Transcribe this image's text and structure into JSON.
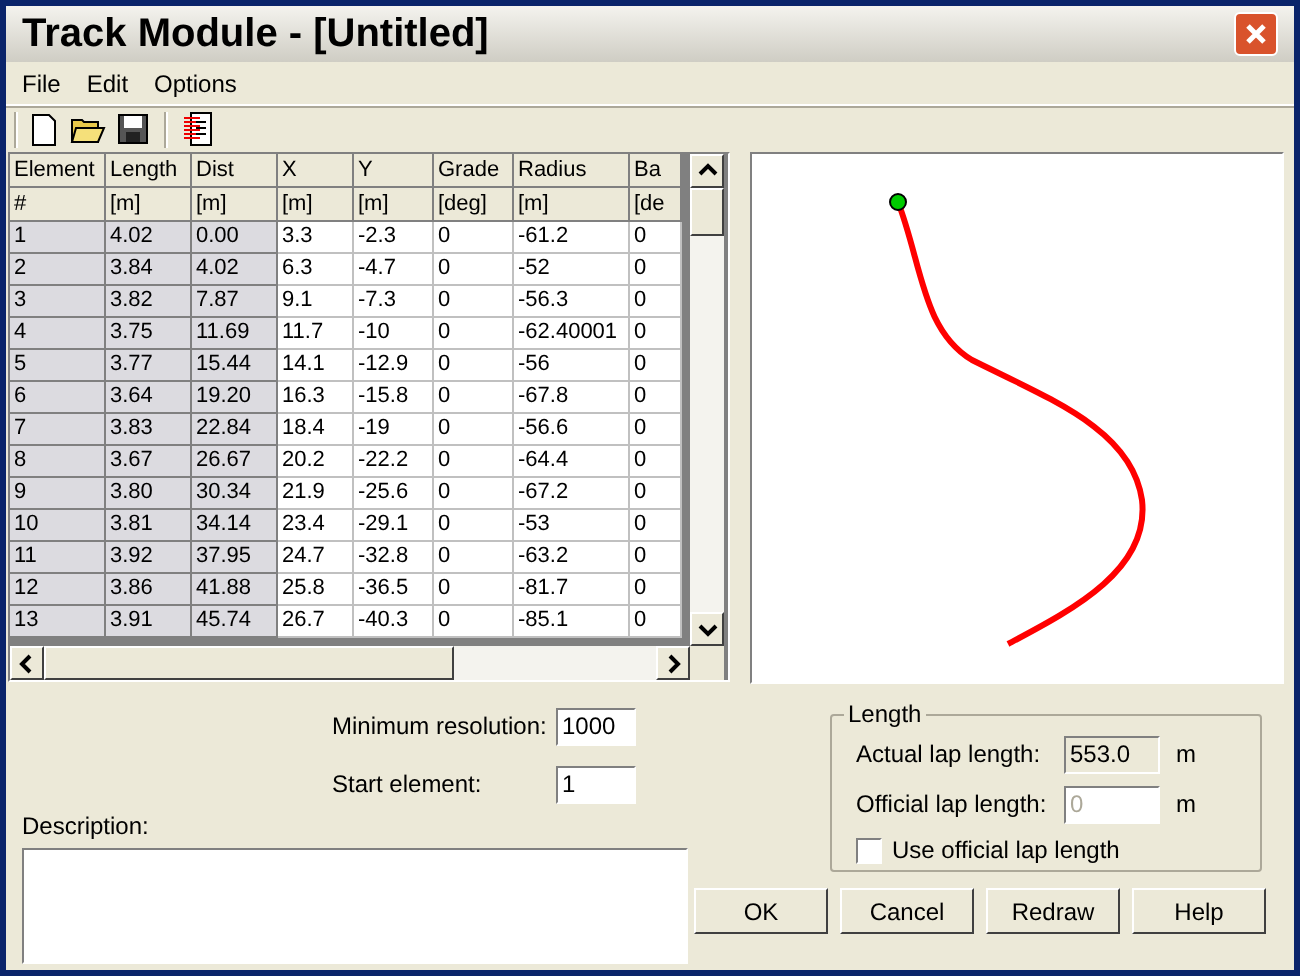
{
  "window": {
    "title": "Track Module - [Untitled]"
  },
  "menu": [
    "File",
    "Edit",
    "Options"
  ],
  "table": {
    "columns": [
      {
        "label": "Element",
        "unit": "#",
        "fixed": true
      },
      {
        "label": "Length",
        "unit": "[m]",
        "fixed": true
      },
      {
        "label": "Dist",
        "unit": "[m]",
        "fixed": true
      },
      {
        "label": "X",
        "unit": "[m]",
        "fixed": false
      },
      {
        "label": "Y",
        "unit": "[m]",
        "fixed": false
      },
      {
        "label": "Grade",
        "unit": "[deg]",
        "fixed": false
      },
      {
        "label": "Radius",
        "unit": "[m]",
        "fixed": false
      },
      {
        "label": "Ba",
        "unit": "[de",
        "fixed": false
      }
    ],
    "rows": [
      [
        "1",
        "4.02",
        "0.00",
        "3.3",
        "-2.3",
        "0",
        "-61.2",
        "0"
      ],
      [
        "2",
        "3.84",
        "4.02",
        "6.3",
        "-4.7",
        "0",
        "-52",
        "0"
      ],
      [
        "3",
        "3.82",
        "7.87",
        "9.1",
        "-7.3",
        "0",
        "-56.3",
        "0"
      ],
      [
        "4",
        "3.75",
        "11.69",
        "11.7",
        "-10",
        "0",
        "-62.40001",
        "0"
      ],
      [
        "5",
        "3.77",
        "15.44",
        "14.1",
        "-12.9",
        "0",
        "-56",
        "0"
      ],
      [
        "6",
        "3.64",
        "19.20",
        "16.3",
        "-15.8",
        "0",
        "-67.8",
        "0"
      ],
      [
        "7",
        "3.83",
        "22.84",
        "18.4",
        "-19",
        "0",
        "-56.6",
        "0"
      ],
      [
        "8",
        "3.67",
        "26.67",
        "20.2",
        "-22.2",
        "0",
        "-64.4",
        "0"
      ],
      [
        "9",
        "3.80",
        "30.34",
        "21.9",
        "-25.6",
        "0",
        "-67.2",
        "0"
      ],
      [
        "10",
        "3.81",
        "34.14",
        "23.4",
        "-29.1",
        "0",
        "-53",
        "0"
      ],
      [
        "11",
        "3.92",
        "37.95",
        "24.7",
        "-32.8",
        "0",
        "-63.2",
        "0"
      ],
      [
        "12",
        "3.86",
        "41.88",
        "25.8",
        "-36.5",
        "0",
        "-81.7",
        "0"
      ],
      [
        "13",
        "3.91",
        "45.74",
        "26.7",
        "-40.3",
        "0",
        "-85.1",
        "0"
      ]
    ]
  },
  "minimum_resolution": {
    "label": "Minimum resolution:",
    "value": "1000"
  },
  "start_element": {
    "label": "Start element:",
    "value": "1"
  },
  "description": {
    "label": "Description:"
  },
  "length": {
    "title": "Length",
    "actual": {
      "label": "Actual lap length:",
      "value": "553.0",
      "unit": "m"
    },
    "official": {
      "label": "Official lap length:",
      "value": "0",
      "unit": "m",
      "disabled": true
    },
    "use_official": {
      "label": "Use official lap length",
      "checked": false
    }
  },
  "buttons": [
    "OK",
    "Cancel",
    "Redraw",
    "Help"
  ]
}
